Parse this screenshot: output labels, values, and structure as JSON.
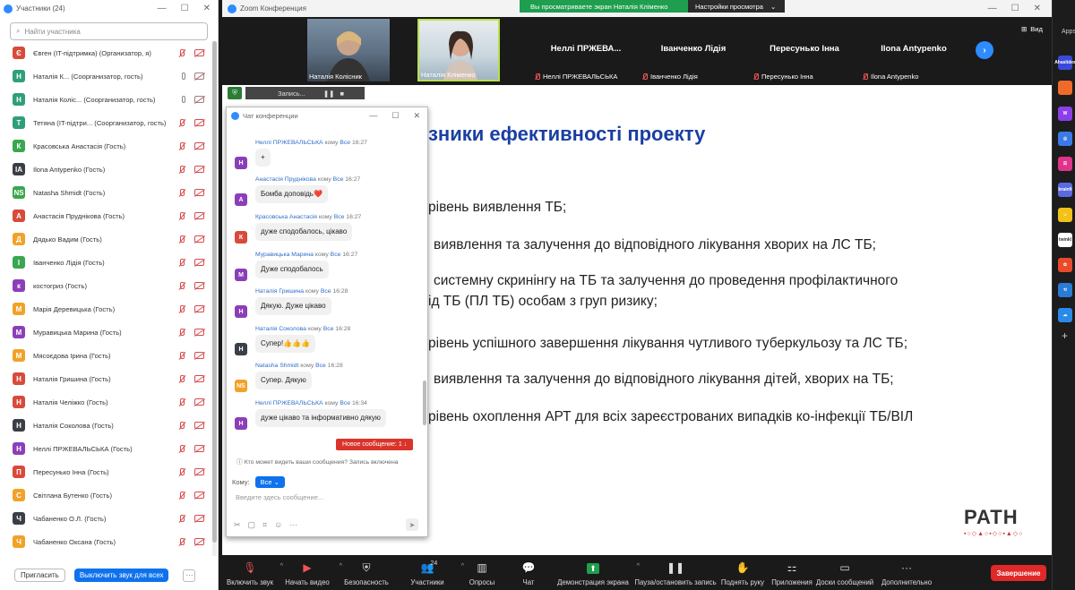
{
  "participants_window": {
    "title": "Участники (24)",
    "search_placeholder": "Найти участника",
    "participants": [
      {
        "initial": "Є",
        "color": "#d84a3a",
        "name": "Євген (IT-підтримка) (Организатор, я)"
      },
      {
        "initial": "Н",
        "color": "#2e9e7b",
        "name": "Наталія К... (Соорганизатор, гость)"
      },
      {
        "initial": "Н",
        "color": "#2e9e7b",
        "name": "Наталія Коліс... (Соорганизатор, гость)"
      },
      {
        "initial": "Т",
        "color": "#2e9e7b",
        "name": "Тетяна (IT-підтри...  (Соорганизатор, гость)"
      },
      {
        "initial": "К",
        "color": "#3aa64f",
        "name": " Красовська Анастасія  (Гость)"
      },
      {
        "initial": "IA",
        "color": "#3a3f47",
        "name": "Ilona Antypenko (Гость)"
      },
      {
        "initial": "NS",
        "color": "#3aa64f",
        "name": "Natasha Shmidt (Гость)"
      },
      {
        "initial": "А",
        "color": "#d84a3a",
        "name": "Анастасія Пруднікова (Гость)"
      },
      {
        "initial": "Д",
        "color": "#f1a228",
        "name": "Дядько Вадим (Гость)"
      },
      {
        "initial": "І",
        "color": "#3aa64f",
        "name": "Іванченко Лідія (Гость)"
      },
      {
        "initial": "к",
        "color": "#8a3fb8",
        "name": "костогриз (Гость)"
      },
      {
        "initial": "М",
        "color": "#f1a228",
        "name": "Марія Деревицька (Гость)"
      },
      {
        "initial": "М",
        "color": "#8a3fb8",
        "name": "Муравицька Марина (Гость)"
      },
      {
        "initial": "М",
        "color": "#f1a228",
        "name": "Мясоєдова Ірина (Гость)"
      },
      {
        "initial": "Н",
        "color": "#d84a3a",
        "name": "Наталія Гришина (Гость)"
      },
      {
        "initial": "Н",
        "color": "#d84a3a",
        "name": "Наталія Челіжко (Гость)"
      },
      {
        "initial": "Н",
        "color": "#3a3f47",
        "name": "Наталія Соколова (Гость)"
      },
      {
        "initial": "Н",
        "color": "#8a3fb8",
        "name": "Неллі ПРЖЕВАЛЬСЬКА (Гость)"
      },
      {
        "initial": "П",
        "color": "#d84a3a",
        "name": "Пересунько Інна (Гость)"
      },
      {
        "initial": "С",
        "color": "#f1a228",
        "name": "Світлана Бутенко (Гость)"
      },
      {
        "initial": "Ч",
        "color": "#3a3f47",
        "name": "Чабаненко О.Л. (Гость)"
      },
      {
        "initial": "Ч",
        "color": "#f1a228",
        "name": "Чабаненко Оксана (Гость)"
      }
    ],
    "invite_label": "Пригласить",
    "mute_all_label": "Выключить звук для всех",
    "more_label": "···"
  },
  "main_window": {
    "title": "Zoom Конференция",
    "share_banner": "Вы просматриваете экран Наталія Кліменко",
    "view_settings": "Настройки просмотра",
    "view_label": "Вид",
    "video_tiles": [
      {
        "name": "Наталія Колісник"
      },
      {
        "name": "Наталія Кліменко"
      }
    ],
    "name_tiles": [
      {
        "big": "Неллі ПРЖЕВА...",
        "small": "Неллі ПРЖЕВАЛЬСЬКА"
      },
      {
        "big": "Іванченко Лідія",
        "small": "Іванченко Лідія"
      },
      {
        "big": "Пересунько Інна",
        "small": "Пересунько Інна"
      },
      {
        "big": "Ilona Antypenko",
        "small": "Ilona Antypenko"
      }
    ],
    "recording_label": "Запись...",
    "slide": {
      "title": "зники ефективності проекту",
      "lines": [
        "рівень виявлення ТБ;",
        "виявлення та залучення до відповідного лікування хворих на ЛС ТБ;",
        "системну скринінгу на ТБ та залучення до проведення профілактичного",
        "ід ТБ (ПЛ ТБ) особам з груп ризику;",
        "рівень успішного завершення лікування чутливого туберкульозу та ЛС ТБ;",
        "виявлення та залучення до відповідного лікування дітей, хворих на ТБ;",
        "рівень охоплення АРТ для всіх зареєстрованих випадків ко-інфекції ТБ/ВІЛ"
      ],
      "logo": "PATH"
    },
    "toolbar": [
      {
        "label": "Включить звук",
        "icon": "microphone-off-icon"
      },
      {
        "label": "Начать видео",
        "icon": "camera-off-icon"
      },
      {
        "label": "Безопасность",
        "icon": "shield-icon"
      },
      {
        "label": "Участники",
        "icon": "participants-icon",
        "count": "24"
      },
      {
        "label": "Опросы",
        "icon": "polls-icon"
      },
      {
        "label": "Чат",
        "icon": "chat-icon"
      },
      {
        "label": "Демонстрация экрана",
        "icon": "share-screen-icon"
      },
      {
        "label": "Пауза/остановить запись",
        "icon": "pause-record-icon"
      },
      {
        "label": "Поднять руку",
        "icon": "raise-hand-icon"
      },
      {
        "label": "Приложения",
        "icon": "apps-icon"
      },
      {
        "label": "Доски сообщений",
        "icon": "whiteboard-icon"
      },
      {
        "label": "Дополнительно",
        "icon": "more-icon"
      }
    ],
    "end_label": "Завершение"
  },
  "chat_window": {
    "title": "Чат конференции",
    "messages": [
      {
        "sender": "Неллі ПРЖЕВАЛЬСЬКА",
        "to": "Все",
        "time": "16:27",
        "initial": "Н",
        "color": "#8a3fb8",
        "text": "+"
      },
      {
        "sender": "Анастасія Пруднікова",
        "to": "Все",
        "time": "16:27",
        "initial": "А",
        "color": "#8a3fb8",
        "text": "Бомба доповідь❤️"
      },
      {
        "sender": " Красовська Анастасія",
        "to": "Все",
        "time": "16:27",
        "initial": "К",
        "color": "#d84a3a",
        "text": "дуже сподобалось, цікаво"
      },
      {
        "sender": "Муравицька Марина",
        "to": "Все",
        "time": "16:27",
        "initial": "М",
        "color": "#8a3fb8",
        "text": "Дуже сподобалось"
      },
      {
        "sender": "Наталія Гришина",
        "to": "Все",
        "time": "16:28",
        "initial": "Н",
        "color": "#8a3fb8",
        "text": "Дякую. Дуже цікаво"
      },
      {
        "sender": "Наталія Соколова",
        "to": "Все",
        "time": "16:28",
        "initial": "Н",
        "color": "#3a3f47",
        "text": "Супер!👍👍👍"
      },
      {
        "sender": "Natasha Shmidt",
        "to": "Все",
        "time": "16:28",
        "initial": "NS",
        "color": "#f1a228",
        "text": "Супер. Дякую"
      },
      {
        "sender": "Неллі ПРЖЕВАЛЬСЬКА",
        "to": "Все",
        "time": "16:34",
        "initial": "Н",
        "color": "#8a3fb8",
        "text": "дуже цікаво та інформативно дякую"
      }
    ],
    "to_word": "кому",
    "new_message": "Новое сообщение: 1 ↓",
    "who_can_see": "Кто может видеть ваши сообщения? Запись включена",
    "to_label": "Кому:",
    "to_value": "Все",
    "input_placeholder": "Введите здесь сообщение..."
  },
  "colors": {
    "accent": "#0e72ed",
    "danger": "#e02828",
    "share_green": "#1f9e4f",
    "slide_title": "#1a3fa3"
  }
}
